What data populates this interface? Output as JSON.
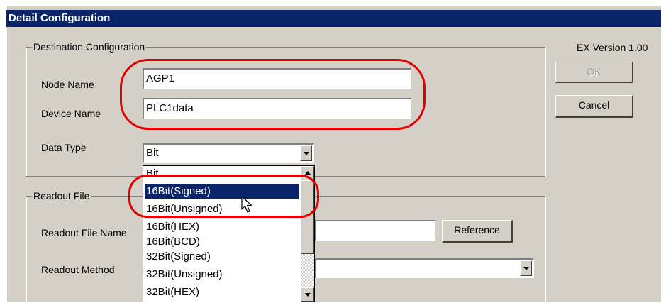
{
  "window": {
    "title": "Detail Configuration"
  },
  "version_label": "EX Version 1.00",
  "buttons": {
    "ok": "OK",
    "cancel": "Cancel",
    "reference": "Reference"
  },
  "destination": {
    "legend": "Destination Configuration",
    "node_name_label": "Node Name",
    "node_name_value": "AGP1",
    "device_name_label": "Device Name",
    "device_name_value": "PLC1data",
    "data_type_label": "Data Type",
    "data_type_value": "Bit"
  },
  "readout": {
    "legend": "Readout File",
    "file_name_label": "Readout File Name",
    "method_label": "Readout Method"
  },
  "dropdown": {
    "options": [
      "Bit",
      "16Bit(Signed)",
      "16Bit(Unsigned)",
      "16Bit(HEX)",
      "16Bit(BCD)",
      "32Bit(Signed)",
      "32Bit(Unsigned)",
      "32Bit(HEX)"
    ],
    "selected": "16Bit(Signed)"
  },
  "colors": {
    "highlight": "#e00000",
    "titlebar": "#0a246a",
    "face": "#d4d0c8"
  }
}
